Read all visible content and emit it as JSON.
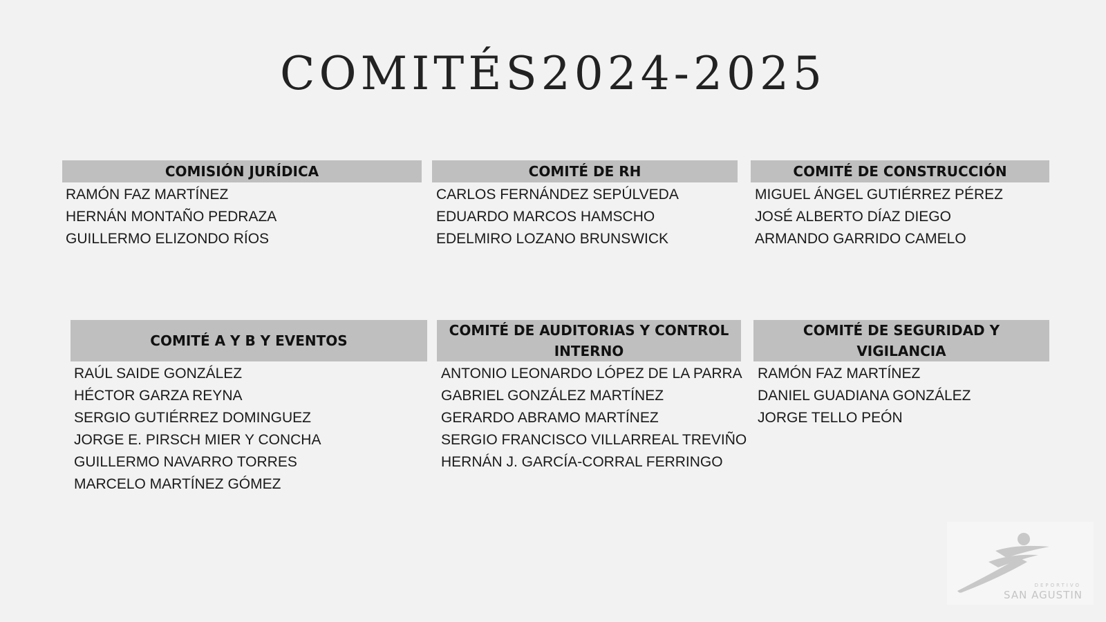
{
  "title": "COMITÉS2024-2025",
  "committees": [
    {
      "title": "COMISIÓN JURÍDICA",
      "members": [
        "RAMÓN FAZ MARTÍNEZ",
        "HERNÁN MONTAÑO PEDRAZA",
        "GUILLERMO ELIZONDO RÍOS"
      ]
    },
    {
      "title": "COMITÉ DE RH",
      "members": [
        "CARLOS FERNÁNDEZ SEPÚLVEDA",
        "EDUARDO MARCOS HAMSCHO",
        "EDELMIRO LOZANO BRUNSWICK"
      ]
    },
    {
      "title": "COMITÉ DE CONSTRUCCIÓN",
      "members": [
        "MIGUEL ÁNGEL GUTIÉRREZ PÉREZ",
        "JOSÉ ALBERTO DÍAZ DIEGO",
        "ARMANDO GARRIDO CAMELO"
      ]
    },
    {
      "title": "COMITÉ A Y B Y EVENTOS",
      "members": [
        "RAÚL SAIDE GONZÁLEZ",
        "HÉCTOR GARZA REYNA",
        "SERGIO GUTIÉRREZ DOMINGUEZ",
        "JORGE E. PIRSCH MIER Y CONCHA",
        "GUILLERMO NAVARRO TORRES",
        "MARCELO MARTÍNEZ GÓMEZ"
      ]
    },
    {
      "title": "COMITÉ DE AUDITORIAS Y CONTROL INTERNO",
      "members": [
        "ANTONIO LEONARDO LÓPEZ DE LA PARRA",
        "GABRIEL GONZÁLEZ MARTÍNEZ",
        "GERARDO ABRAMO MARTÍNEZ",
        "SERGIO FRANCISCO VILLARREAL TREVIÑO",
        "HERNÁN J. GARCÍA-CORRAL FERRINGO"
      ]
    },
    {
      "title": "COMITÉ DE SEGURIDAD Y VIGILANCIA",
      "members": [
        "RAMÓN FAZ MARTÍNEZ",
        "DANIEL GUADIANA GONZÁLEZ",
        "JORGE TELLO PEÓN"
      ]
    }
  ],
  "logo": {
    "small_text": "DEPORTIVO",
    "name": "SAN AGUSTIN",
    "color": "#c4c4c4"
  }
}
